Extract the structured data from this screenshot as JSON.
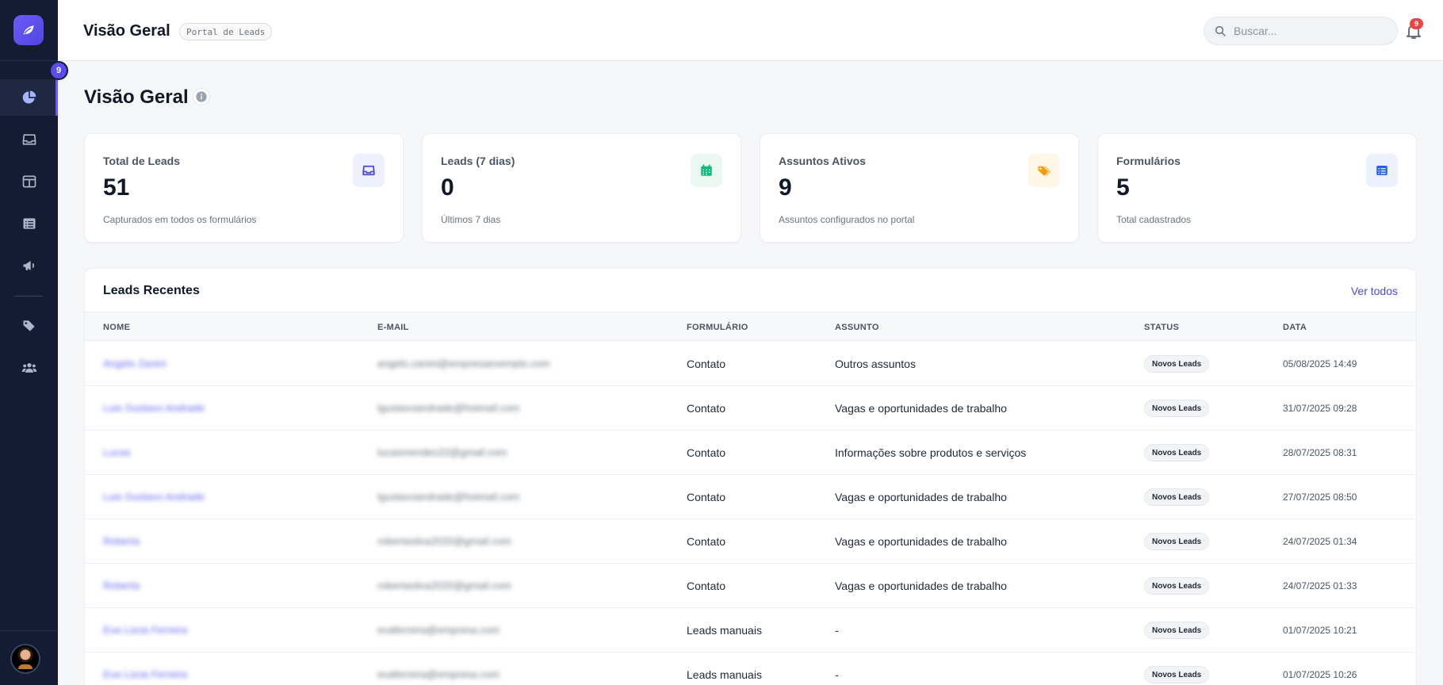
{
  "topbar": {
    "title": "Visão Geral",
    "chip": "Portal de Leads",
    "search_placeholder": "Buscar...",
    "notification_count": "9"
  },
  "sidebar": {
    "badge": "9",
    "items": [
      {
        "icon": "pie-chart-icon",
        "active": true
      },
      {
        "icon": "inbox-icon",
        "active": false
      },
      {
        "icon": "layout-icon",
        "active": false
      },
      {
        "icon": "list-icon",
        "active": false
      },
      {
        "icon": "megaphone-icon",
        "active": false
      },
      {
        "icon": "tags-icon",
        "active": false
      },
      {
        "icon": "users-icon",
        "active": false
      }
    ]
  },
  "main": {
    "page_title": "Visão Geral",
    "cards": [
      {
        "label": "Total de Leads",
        "value": "51",
        "sub": "Capturados em todos os formulários",
        "icon": "inbox-icon",
        "icon_color": "#4f46e5",
        "icon_bg": "#eef0fb"
      },
      {
        "label": "Leads (7 dias)",
        "value": "0",
        "sub": "Últimos 7 dias",
        "icon": "calendar-icon",
        "icon_color": "#10b981",
        "icon_bg": "#ebf8f2"
      },
      {
        "label": "Assuntos Ativos",
        "value": "9",
        "sub": "Assuntos configurados no portal",
        "icon": "tags-icon",
        "icon_color": "#f59e0b",
        "icon_bg": "#fef6e7"
      },
      {
        "label": "Formulários",
        "value": "5",
        "sub": "Total cadastrados",
        "icon": "list-icon",
        "icon_color": "#2563eb",
        "icon_bg": "#ecf1fb"
      }
    ],
    "recent": {
      "title": "Leads Recentes",
      "see_all": "Ver todos",
      "columns": [
        "NOME",
        "E-MAIL",
        "FORMULÁRIO",
        "ASSUNTO",
        "STATUS",
        "DATA"
      ],
      "rows": [
        {
          "name": "Angelo Zanini",
          "email": "angelo.zanini@empresaexemplo.com",
          "form": "Contato",
          "subject": "Outros assuntos",
          "status": "Novos Leads",
          "date": "05/08/2025 14:49"
        },
        {
          "name": "Luis Gustavo Andrade",
          "email": "lgustavoandrade@hotmail.com",
          "form": "Contato",
          "subject": "Vagas e oportunidades de trabalho",
          "status": "Novos Leads",
          "date": "31/07/2025 09:28"
        },
        {
          "name": "Lucas",
          "email": "lucasmendes22@gmail.com",
          "form": "Contato",
          "subject": "Informações sobre produtos e serviços",
          "status": "Novos Leads",
          "date": "28/07/2025 08:31"
        },
        {
          "name": "Luis Gustavo Andrade",
          "email": "lgustavoandrade@hotmail.com",
          "form": "Contato",
          "subject": "Vagas e oportunidades de trabalho",
          "status": "Novos Leads",
          "date": "27/07/2025 08:50"
        },
        {
          "name": "Roberta",
          "email": "robertasilva2020@gmail.com",
          "form": "Contato",
          "subject": "Vagas e oportunidades de trabalho",
          "status": "Novos Leads",
          "date": "24/07/2025 01:34"
        },
        {
          "name": "Roberta",
          "email": "robertasilva2020@gmail.com",
          "form": "Contato",
          "subject": "Vagas e oportunidades de trabalho",
          "status": "Novos Leads",
          "date": "24/07/2025 01:33"
        },
        {
          "name": "Eva Lúcia Ferreira",
          "email": "evaferreira@empresa.com",
          "form": "Leads manuais",
          "subject": "-",
          "status": "Novos Leads",
          "date": "01/07/2025 10:21"
        },
        {
          "name": "Eva Lúcia Ferreira",
          "email": "evaferreira@empresa.com",
          "form": "Leads manuais",
          "subject": "-",
          "status": "Novos Leads",
          "date": "01/07/2025 10:26"
        }
      ]
    }
  }
}
